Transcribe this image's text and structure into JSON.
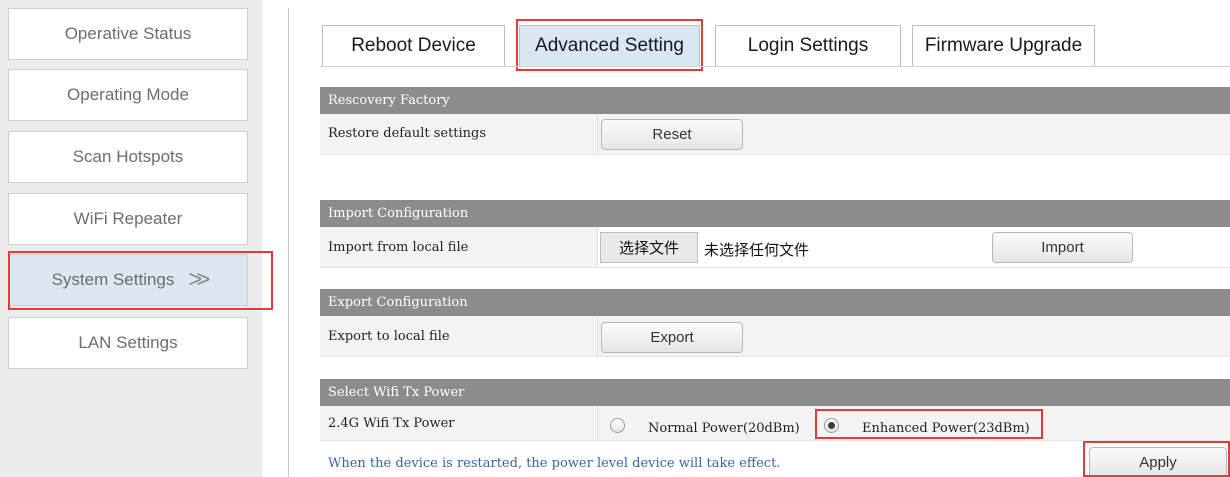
{
  "sidebar": {
    "items": [
      {
        "label": "Operative Status"
      },
      {
        "label": "Operating Mode"
      },
      {
        "label": "Scan Hotspots"
      },
      {
        "label": "WiFi Repeater"
      },
      {
        "label": "System Settings",
        "suffix": ">>"
      },
      {
        "label": "LAN Settings"
      }
    ],
    "active_index": 4
  },
  "tabs": [
    {
      "label": "Reboot Device"
    },
    {
      "label": "Advanced Setting"
    },
    {
      "label": "Login Settings"
    },
    {
      "label": "Firmware Upgrade"
    }
  ],
  "sections": {
    "recovery": {
      "header": "Rescovery Factory",
      "row_label": "Restore default settings",
      "button": "Reset"
    },
    "import": {
      "header": "Import Configuration",
      "row_label": "Import from local file",
      "file_button": "选择文件",
      "file_status": "未选择任何文件",
      "button": "Import"
    },
    "export": {
      "header": "Export Configuration",
      "row_label": "Export to local file",
      "button": "Export"
    },
    "tx_power": {
      "header": "Select Wifi Tx Power",
      "row_label": "2.4G Wifi Tx Power",
      "options": [
        {
          "label": "Normal Power(20dBm)",
          "checked": false
        },
        {
          "label": "Enhanced Power(23dBm)",
          "checked": true
        }
      ],
      "note": "When the device is restarted, the power level device will take effect.",
      "button": "Apply"
    }
  },
  "colors": {
    "highlight": "#e23b3b",
    "section_header": "#8c8c8c",
    "active_tab": "#dbe6f3",
    "note_text": "#3b62a8"
  }
}
